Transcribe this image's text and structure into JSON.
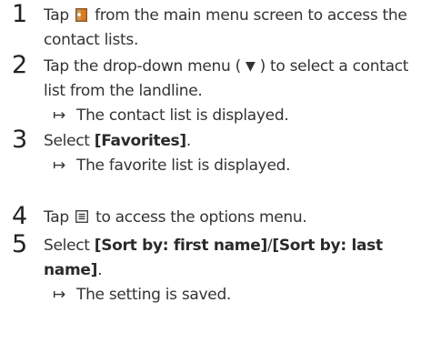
{
  "steps": [
    {
      "number": "1",
      "before_icon": "Tap",
      "icon": "contacts-book-icon",
      "after_icon": "from the main menu screen to access the contact lists."
    },
    {
      "number": "2",
      "pre": "Tap the drop-down menu (",
      "triangle": "▼",
      "post": ") to select a contact list from the landline.",
      "result_arrow": "↦",
      "result": "The contact list is displayed."
    },
    {
      "number": "3",
      "pre": "Select",
      "bold": "[Favorites]",
      "post": ".",
      "result_arrow": "↦",
      "result": "The favorite list is displayed."
    },
    {
      "number": "4",
      "before_icon": "Tap",
      "icon": "options-menu-icon",
      "after_icon": "to access the options menu."
    },
    {
      "number": "5",
      "pre": "Select",
      "bold1": "[Sort by: first name]",
      "sep": "/",
      "bold2": "[Sort by: last name]",
      "post": ".",
      "result_arrow": "↦",
      "result": "The setting is saved."
    }
  ],
  "colors": {
    "text": "#333333",
    "icon_brown": "#8a5a2b",
    "icon_orange": "#e07a1f"
  }
}
